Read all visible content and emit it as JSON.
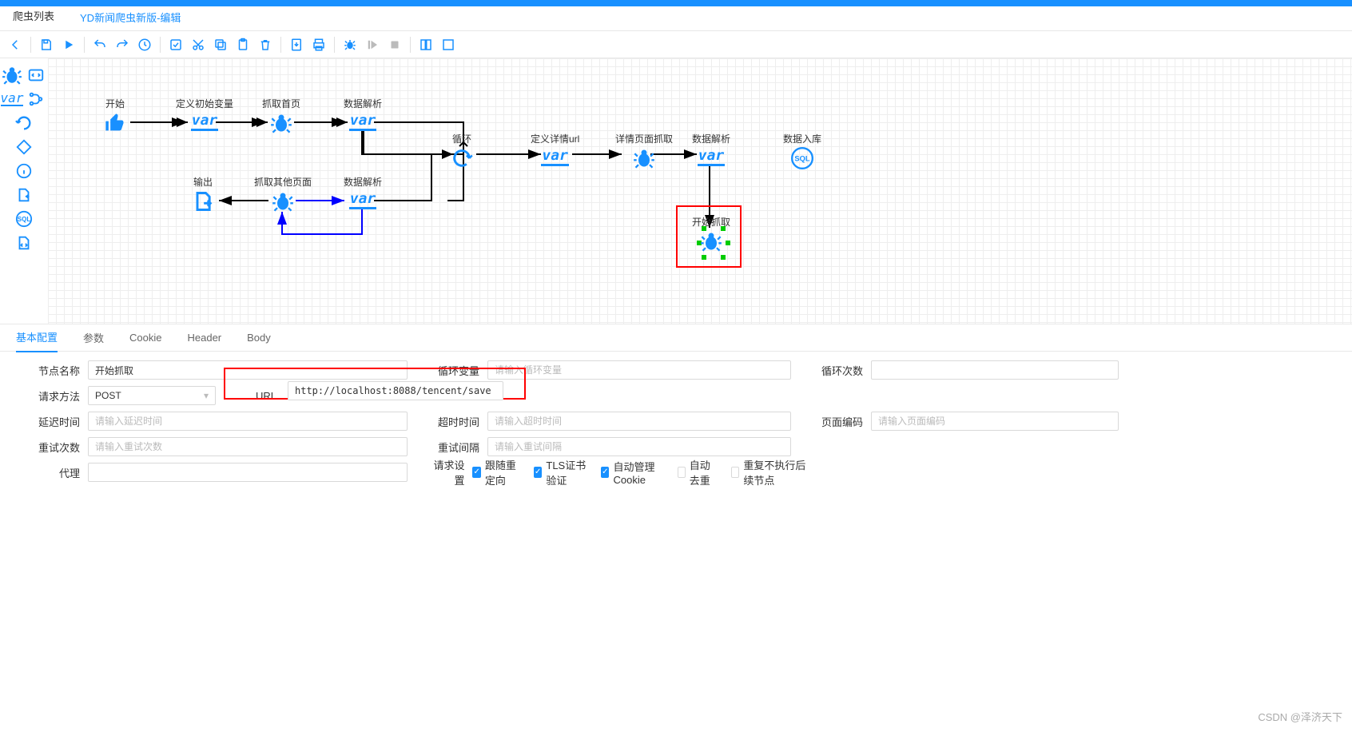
{
  "tabs": {
    "list": "爬虫列表",
    "edit": "YD新闻爬虫新版-编辑"
  },
  "nodes": {
    "start": "开始",
    "defInitVar": "定义初始变量",
    "crawlHome": "抓取首页",
    "parse1": "数据解析",
    "loop": "循环",
    "defDetailUrl": "定义详情url",
    "detailCrawl": "详情页面抓取",
    "parse2": "数据解析",
    "toDb": "数据入库",
    "output": "输出",
    "crawlOtherPages": "抓取其他页面",
    "parse3": "数据解析",
    "startCrawl": "开始抓取"
  },
  "varText": "var",
  "panelTabs": {
    "basic": "基本配置",
    "params": "参数",
    "cookie": "Cookie",
    "header": "Header",
    "body": "Body"
  },
  "form": {
    "labels": {
      "nodeName": "节点名称",
      "method": "请求方法",
      "url": "URL",
      "delay": "延迟时间",
      "retry": "重试次数",
      "proxy": "代理",
      "loopVar": "循环变量",
      "timeout": "超时时间",
      "retryInterval": "重试间隔",
      "reqSettings": "请求设置",
      "loopCount": "循环次数",
      "pageEncoding": "页面编码"
    },
    "values": {
      "nodeName": "开始抓取",
      "method": "POST",
      "url": "http://localhost:8088/tencent/save"
    },
    "placeholders": {
      "delay": "请输入延迟时间",
      "retry": "请输入重试次数",
      "loopVar": "请输入循环变量",
      "timeout": "请输入超时时间",
      "retryInterval": "请输入重试间隔",
      "pageEncoding": "请输入页面编码"
    },
    "checkboxes": {
      "followRedirect": "跟随重定向",
      "tlsVerify": "TLS证书验证",
      "autoCookie": "自动管理Cookie",
      "autoDedup": "自动去重",
      "repeatNoExec": "重复不执行后续节点"
    }
  },
  "watermark": "CSDN @泽济天下"
}
